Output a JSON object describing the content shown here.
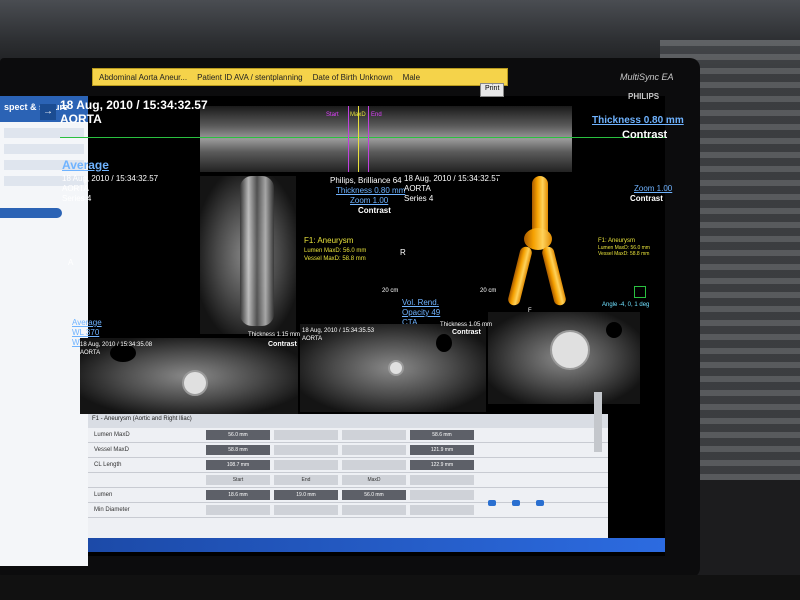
{
  "patient_bar": {
    "study": "Abdominal Aorta Aneur...",
    "patient_id": "Patient ID AVA / stentplanning",
    "dob": "Date of Birth Unknown",
    "sex": "Male",
    "print_label": "Print"
  },
  "brand": {
    "monitor": "MultiSync EA",
    "vendor": "PHILIPS"
  },
  "left_panel": {
    "header": "spect & sasure",
    "arrow": "→"
  },
  "top_view": {
    "timestamp": "18 Aug, 2010 / 15:34:32.57",
    "label": "AORTA",
    "thickness": "Thickness 0.80 mm",
    "mode": "Contrast",
    "markers": [
      "Start",
      "MaxD",
      "End"
    ]
  },
  "left_view": {
    "title": "Average",
    "timestamp": "18 Aug, 2010 / 15:34:32.57",
    "label": "AORTA",
    "series": "Series 4",
    "scanner": "Philips, Brilliance 64",
    "thickness": "Thickness 0.80 mm",
    "zoom": "Zoom 1.00",
    "mode": "Contrast",
    "orient_left": "A",
    "orient_right": "R",
    "scale": "20 cm",
    "annotation_1": "F1: Aneurysm",
    "annotation_2": "Lumen MaxD: 56.0 mm",
    "annotation_3": "Vessel MaxD: 58.8 mm",
    "footer_1": "Average",
    "footer_2": "WL 370",
    "footer_3": "WW 1400"
  },
  "right_view": {
    "timestamp": "18 Aug, 2010 / 15:34:32.57",
    "label": "AORTA",
    "series": "Series 4",
    "zoom": "Zoom 1.00",
    "mode": "Contrast",
    "annotation_1": "F1: Aneurysm",
    "annotation_2": "Lumen MaxD: 56.0 mm",
    "annotation_3": "Vessel MaxD: 58.8 mm",
    "vol_rend": "Vol. Rend.",
    "opacity": "Opacity 49",
    "preset": "CTA",
    "angle": "Angle -4, 0, 1 deg",
    "scale": "20 cm",
    "orient": "F"
  },
  "bottom_views": {
    "left_time": "18 Aug, 2010 / 15:34:35.08",
    "left_label": "AORTA",
    "mid_thickness": "Thickness 1.15 mm",
    "mid_mode": "Contrast",
    "mid_time": "18 Aug, 2010 / 15:34:35.53",
    "mid_label": "AORTA",
    "right_thickness": "Thickness 1.05 mm",
    "right_mode": "Contrast"
  },
  "table": {
    "title": "F1 - Aneurysm (Aortic and Right Iliac)",
    "rows": [
      {
        "k": "Lumen MaxD",
        "c1": "56.0 mm",
        "c2": "",
        "c3": "",
        "c4": "58.6 mm"
      },
      {
        "k": "Vessel MaxD",
        "c1": "58.8 mm",
        "c2": "",
        "c3": "",
        "c4": "121.9 mm"
      },
      {
        "k": "CL Length",
        "c1": "108.7 mm",
        "c2": "",
        "c3": "",
        "c4": "122.9 mm"
      },
      {
        "k": "",
        "c1": "Start",
        "c2": "End",
        "c3": "MaxD",
        "c4": ""
      },
      {
        "k": "Lumen",
        "c1": "18.6 mm",
        "c2": "19.0 mm",
        "c3": "56.0 mm",
        "c4": ""
      },
      {
        "k": "Min Diameter",
        "c1": "",
        "c2": "",
        "c3": "",
        "c4": ""
      }
    ]
  }
}
